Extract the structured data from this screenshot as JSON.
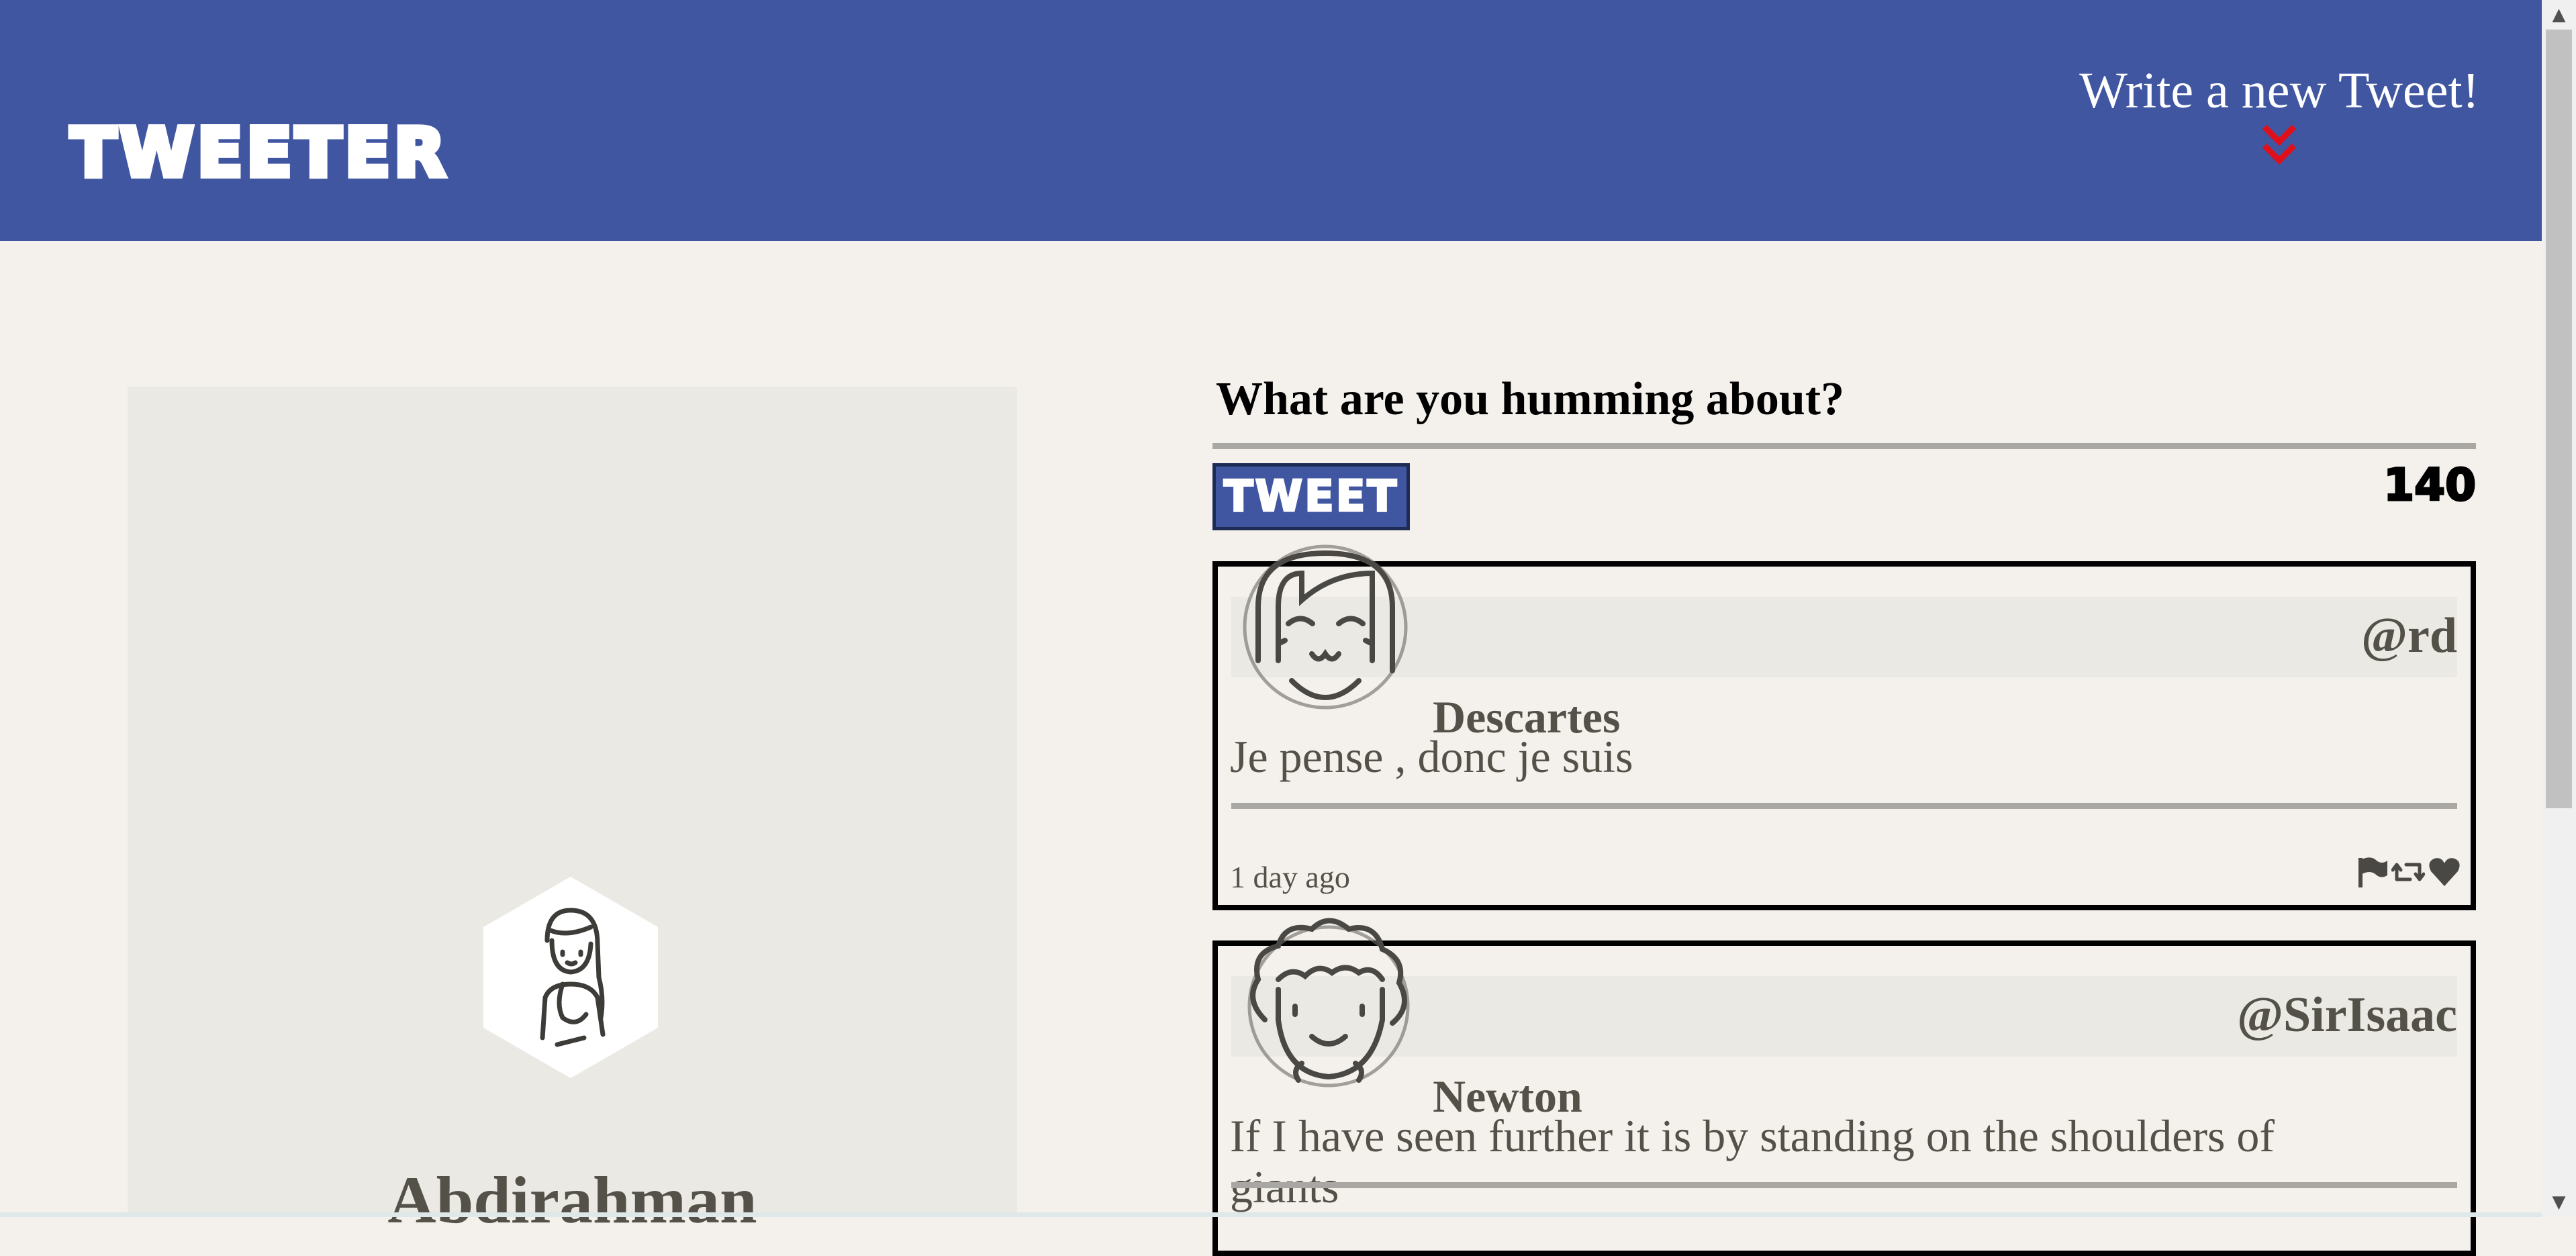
{
  "header": {
    "logo": "TWEETER",
    "write_new_label": "Write a new Tweet!",
    "write_new_icon": "chevron-double-down-icon"
  },
  "profile": {
    "avatar_icon": "user-avatar-icon",
    "name": "Abdirahman"
  },
  "compose": {
    "prompt": "What are you humming about?",
    "tweet_button_label": "TWEET",
    "char_counter": "140"
  },
  "tweets": [
    {
      "handle": "@rd",
      "name": "Descartes",
      "text": "Je pense , donc je suis",
      "time": "1 day ago",
      "avatar_icon": "smiling-girl-avatar-icon"
    },
    {
      "handle": "@SirIsaac",
      "name": "Newton",
      "text": "If I have seen further it is by standing on the shoulders of giants",
      "avatar_icon": "curly-hair-avatar-icon"
    }
  ],
  "actions": [
    "flag-icon",
    "retweet-icon",
    "heart-icon"
  ],
  "colors": {
    "header_bg": "#4056a1",
    "page_bg": "#f4f1ec",
    "panel_bg": "#ebe9e4",
    "accent_chevron": "#e0101a",
    "text": "#545149"
  }
}
